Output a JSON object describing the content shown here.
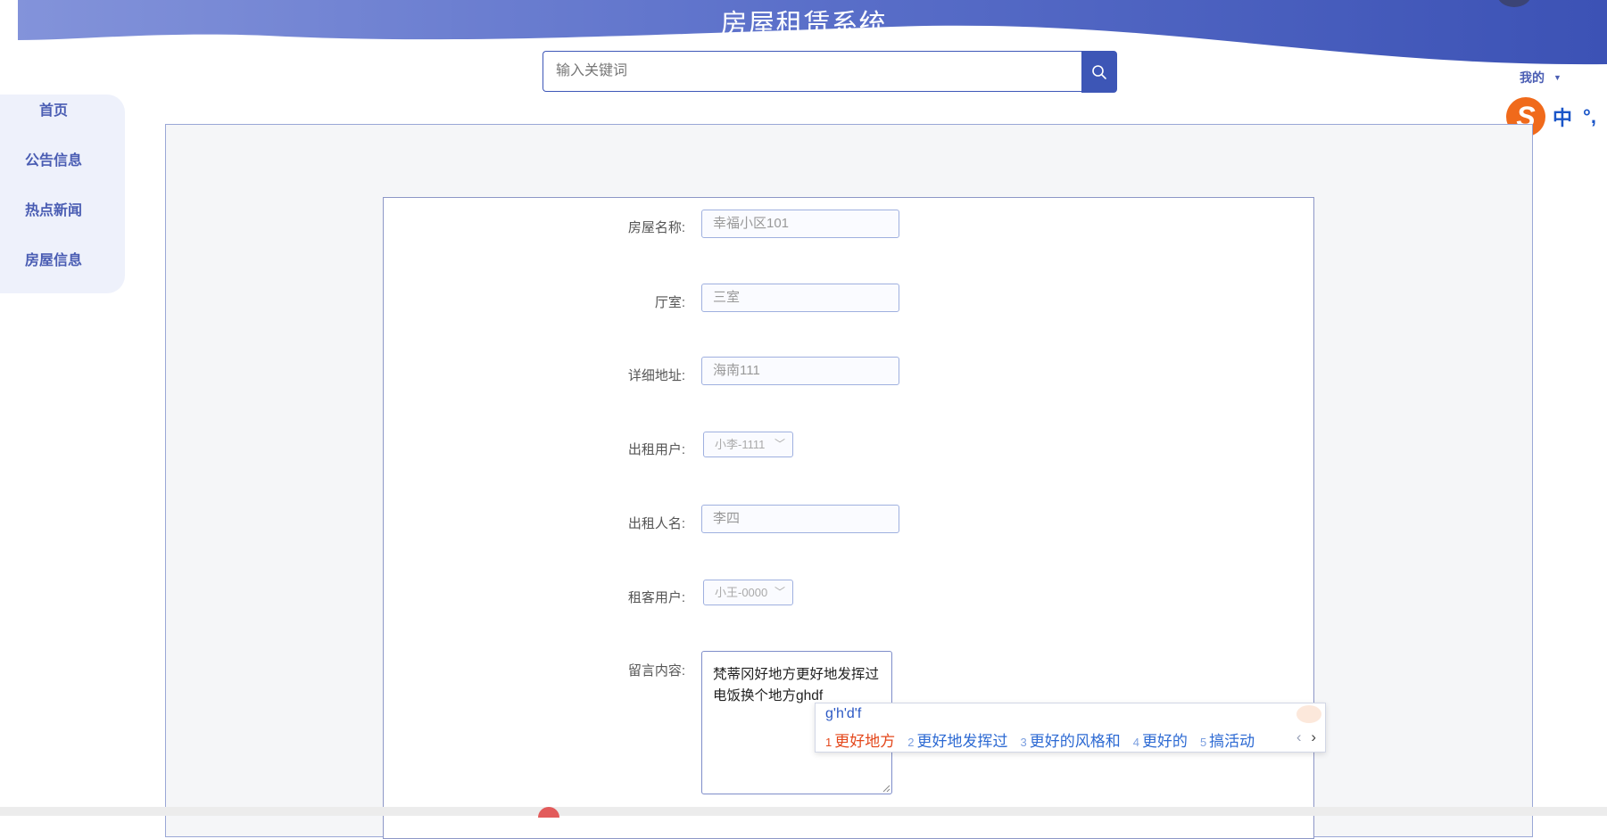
{
  "header": {
    "title": "房屋租赁系统"
  },
  "search": {
    "placeholder": "输入关键词"
  },
  "user_menu": {
    "label": "我的"
  },
  "ime_status": {
    "logo_letter": "S",
    "mode": "中",
    "punct": "°,"
  },
  "sidebar": {
    "items": [
      {
        "label": "首页"
      },
      {
        "label": "公告信息"
      },
      {
        "label": "热点新闻"
      },
      {
        "label": "房屋信息"
      }
    ]
  },
  "form": {
    "house_name": {
      "label": "房屋名称:",
      "value": "幸福小区101"
    },
    "rooms": {
      "label": "厅室:",
      "value": "三室"
    },
    "address": {
      "label": "详细地址:",
      "value": "海南111"
    },
    "landlord_user": {
      "label": "出租用户:",
      "value": "小李-1111"
    },
    "landlord_name": {
      "label": "出租人名:",
      "value": "李四"
    },
    "tenant_user": {
      "label": "租客用户:",
      "value": "小王-0000"
    },
    "message": {
      "label": "留言内容:",
      "value": "梵蒂冈好地方更好地发挥过电饭换个地方ghdf"
    }
  },
  "ime_popup": {
    "pinyin": "g'h'd'f",
    "candidates": [
      {
        "num": "1",
        "text": "更好地方"
      },
      {
        "num": "2",
        "text": "更好地发挥过"
      },
      {
        "num": "3",
        "text": "更好的风格和"
      },
      {
        "num": "4",
        "text": "更好的"
      },
      {
        "num": "5",
        "text": "搞活动"
      }
    ],
    "prev": "‹",
    "next": "›"
  },
  "colors": {
    "brand": "#4a5db3",
    "header_gradient_start": "#7e8fd8",
    "header_gradient_end": "#3e56b8",
    "ime_active": "#e4481c",
    "ime_candidate": "#2d6ad3"
  },
  "icons": {
    "search": "search-icon",
    "dropdown": "chevron-down-icon",
    "ime_logo": "sogou-s-icon"
  }
}
